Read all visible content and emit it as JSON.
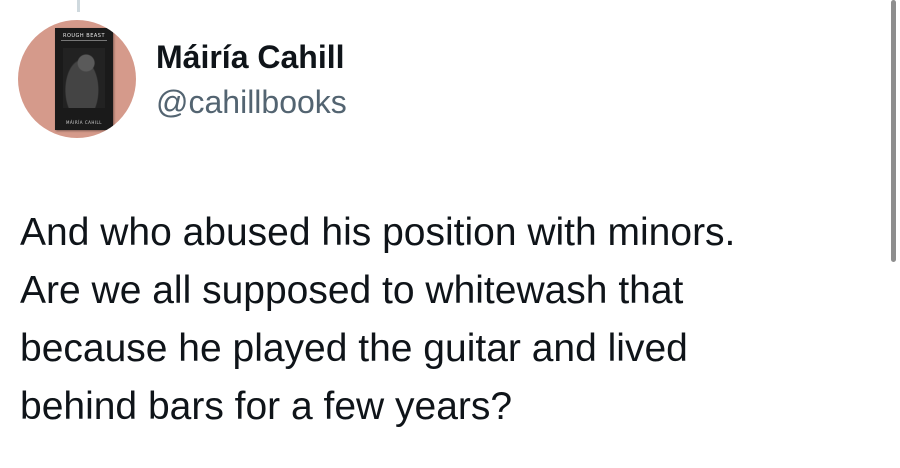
{
  "author": {
    "display_name": "Máiría Cahill",
    "handle": "@cahillbooks",
    "avatar": {
      "book_title": "ROUGH BEAST",
      "book_author": "MÁIRÍA CAHILL"
    }
  },
  "tweet": {
    "lines": [
      "And who abused his position with minors.",
      "Are we all supposed to whitewash that",
      "because he played the guitar and lived",
      "behind bars for a few years?"
    ]
  },
  "colors": {
    "text": "#0f1419",
    "secondary": "#536471",
    "avatar_bg": "#d59a8b"
  }
}
